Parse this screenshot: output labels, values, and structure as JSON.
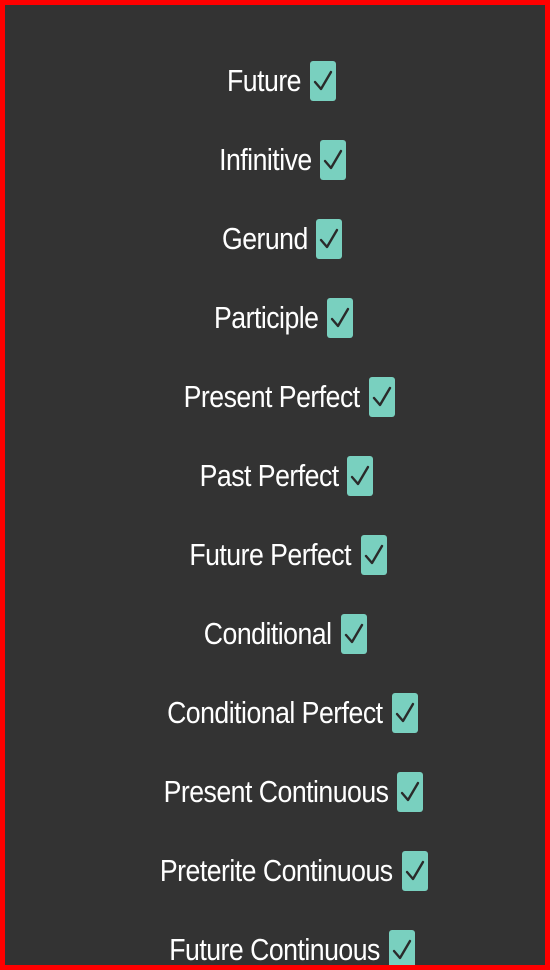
{
  "colors": {
    "frame": "#ff0000",
    "background": "#333333",
    "text": "#ffffff",
    "checkbox_fill": "#79d0bf",
    "checkmark": "#2a2a2a"
  },
  "tenses": [
    {
      "label": "Future",
      "checked": true,
      "icon": "checkmark-icon"
    },
    {
      "label": "Infinitive",
      "checked": true,
      "icon": "checkmark-icon"
    },
    {
      "label": "Gerund",
      "checked": true,
      "icon": "checkmark-icon"
    },
    {
      "label": "Participle",
      "checked": true,
      "icon": "checkmark-icon"
    },
    {
      "label": "Present Perfect",
      "checked": true,
      "icon": "checkmark-icon"
    },
    {
      "label": "Past Perfect",
      "checked": true,
      "icon": "checkmark-icon"
    },
    {
      "label": "Future Perfect",
      "checked": true,
      "icon": "checkmark-icon"
    },
    {
      "label": "Conditional",
      "checked": true,
      "icon": "checkmark-icon"
    },
    {
      "label": "Conditional Perfect",
      "checked": true,
      "icon": "checkmark-icon"
    },
    {
      "label": "Present Continuous",
      "checked": true,
      "icon": "checkmark-icon"
    },
    {
      "label": "Preterite Continuous",
      "checked": true,
      "icon": "checkmark-icon"
    },
    {
      "label": "Future Continuous",
      "checked": true,
      "icon": "checkmark-icon"
    }
  ]
}
